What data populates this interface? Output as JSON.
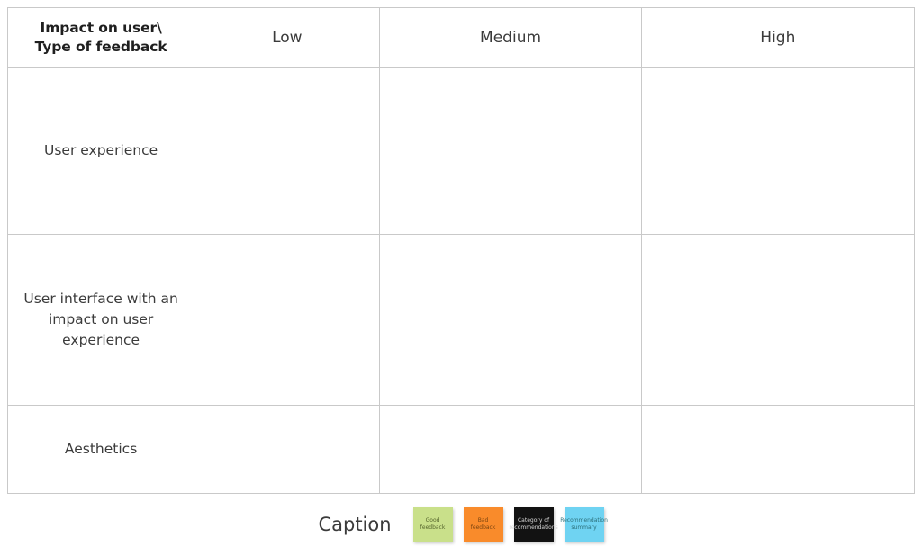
{
  "matrix": {
    "corner_label": "Impact on user\\\nType of feedback",
    "corner_label_line1": "Impact on user\\",
    "corner_label_line2": "Type of feedback",
    "columns": [
      {
        "label": "Low",
        "color": "#dceb9e"
      },
      {
        "label": "Medium",
        "color": "#fbd9a2"
      },
      {
        "label": "High",
        "color": "#f4aaa2"
      }
    ],
    "rows": [
      {
        "label": "User experience",
        "cells": [
          {
            "column": "Low",
            "empty": false
          },
          {
            "column": "Medium",
            "empty": false
          },
          {
            "column": "High",
            "empty": false
          }
        ]
      },
      {
        "label": "User interface with an impact on user experience",
        "cells": [
          {
            "column": "Low",
            "empty": false
          },
          {
            "column": "Medium",
            "empty": false
          },
          {
            "column": "High",
            "empty": true
          }
        ]
      },
      {
        "label": "Aesthetics",
        "cells": [
          {
            "column": "Low",
            "empty": false
          },
          {
            "column": "Medium",
            "empty": false
          },
          {
            "column": "High",
            "empty": true
          }
        ]
      }
    ]
  },
  "legend": {
    "title": "Caption",
    "items": [
      {
        "label": "Good feedback",
        "color": "#c9e08a"
      },
      {
        "label": "Bad feedback",
        "color": "#f98b2b"
      },
      {
        "label": "Category of recommendations",
        "color": "#121212"
      },
      {
        "label": "Recommendation summary",
        "color": "#6fd3f2"
      }
    ]
  },
  "palette": {
    "blue_sticky": "#6fd3f2",
    "orange_sticky": "#f98b2b",
    "green_sticky": "#b7e07e",
    "yellow_sticky": "#fbe38a",
    "dark_label": "#121212",
    "teal_accent": "#17b7bd",
    "grid_border": "#c9c9c9",
    "text": "#3b3b3b"
  }
}
